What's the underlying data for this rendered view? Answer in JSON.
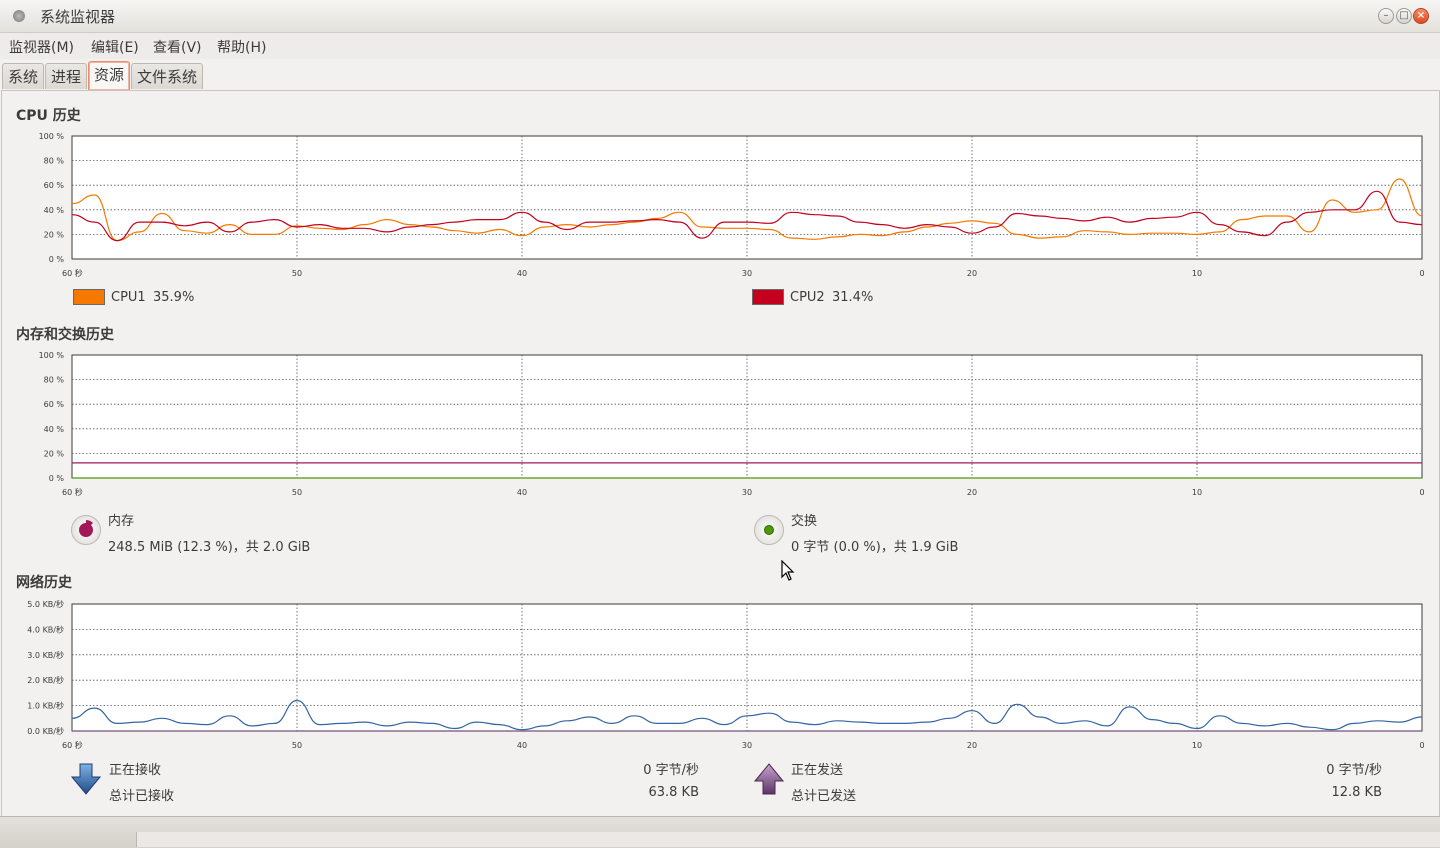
{
  "window": {
    "title": "系统监视器",
    "controls": {
      "minimize": "–",
      "maximize": "□",
      "close": "×"
    }
  },
  "menu": [
    "监视器(M)",
    "编辑(E)",
    "查看(V)",
    "帮助(H)"
  ],
  "tabs": [
    {
      "label": "系统",
      "active": false
    },
    {
      "label": "进程",
      "active": false
    },
    {
      "label": "资源",
      "active": true
    },
    {
      "label": "文件系统",
      "active": false
    }
  ],
  "cpu": {
    "title": "CPU 历史",
    "y_ticks": [
      "100 %",
      "80 %",
      "60 %",
      "40 %",
      "20 %",
      "0 %"
    ],
    "x_ticks": [
      "60 秒",
      "50",
      "40",
      "30",
      "20",
      "10",
      "0"
    ],
    "legend": [
      {
        "name": "CPU1",
        "value": "35.9%",
        "color": "#f57900"
      },
      {
        "name": "CPU2",
        "value": "31.4%",
        "color": "#c4001f"
      }
    ]
  },
  "memory": {
    "title": "内存和交换历史",
    "y_ticks": [
      "100 %",
      "80 %",
      "60 %",
      "40 %",
      "20 %",
      "0 %"
    ],
    "x_ticks": [
      "60 秒",
      "50",
      "40",
      "30",
      "20",
      "10",
      "0"
    ],
    "mem_label": "内存",
    "mem_value": "248.5 MiB (12.3 %)，共 2.0 GiB",
    "mem_color": "#a0185a",
    "swap_label": "交换",
    "swap_value": "0 字节 (0.0 %)，共 1.9 GiB",
    "swap_color": "#4e9a06"
  },
  "network": {
    "title": "网络历史",
    "y_ticks": [
      "5.0 KB/秒",
      "4.0 KB/秒",
      "3.0 KB/秒",
      "2.0 KB/秒",
      "1.0 KB/秒",
      "0.0 KB/秒"
    ],
    "x_ticks": [
      "60 秒",
      "50",
      "40",
      "30",
      "20",
      "10",
      "0"
    ],
    "recv_label": "正在接收",
    "recv_rate": "0 字节/秒",
    "recv_total_label": "总计已接收",
    "recv_total": "63.8 KB",
    "recv_color": "#3465a4",
    "send_label": "正在发送",
    "send_rate": "0 字节/秒",
    "send_total_label": "总计已发送",
    "send_total": "12.8 KB",
    "send_color": "#75507b"
  },
  "chart_data": [
    {
      "type": "line",
      "title": "CPU 历史",
      "ylim": [
        0,
        100
      ],
      "xlim": [
        60,
        0
      ],
      "x": [
        60,
        59,
        58,
        57,
        56,
        55,
        54,
        53,
        52,
        51,
        50,
        49,
        48,
        47,
        46,
        45,
        44,
        43,
        42,
        41,
        40,
        39,
        38,
        37,
        36,
        35,
        34,
        33,
        32,
        31,
        30,
        29,
        28,
        27,
        26,
        25,
        24,
        23,
        22,
        21,
        20,
        19,
        18,
        17,
        16,
        15,
        14,
        13,
        12,
        11,
        10,
        9,
        8,
        7,
        6,
        5,
        4,
        3,
        2,
        1,
        0
      ],
      "series": [
        {
          "name": "CPU1",
          "color": "#f57900",
          "values": [
            45,
            52,
            15,
            22,
            37,
            23,
            21,
            28,
            20,
            20,
            27,
            25,
            24,
            28,
            32,
            28,
            26,
            23,
            21,
            24,
            19,
            26,
            28,
            26,
            28,
            30,
            33,
            38,
            26,
            25,
            25,
            24,
            17,
            16,
            18,
            20,
            19,
            22,
            26,
            29,
            31,
            29,
            20,
            17,
            18,
            23,
            22,
            20,
            21,
            21,
            20,
            22,
            32,
            35,
            35,
            22,
            48,
            38,
            40,
            65,
            35
          ]
        },
        {
          "name": "CPU2",
          "color": "#c4001f",
          "values": [
            36,
            30,
            15,
            30,
            30,
            27,
            30,
            22,
            30,
            32,
            26,
            28,
            25,
            25,
            22,
            26,
            28,
            30,
            32,
            32,
            38,
            30,
            24,
            30,
            30,
            31,
            32,
            30,
            17,
            30,
            30,
            29,
            38,
            36,
            35,
            30,
            28,
            25,
            28,
            26,
            21,
            26,
            37,
            35,
            33,
            31,
            34,
            30,
            33,
            34,
            38,
            28,
            22,
            19,
            30,
            38,
            40,
            40,
            55,
            30,
            28
          ]
        }
      ]
    },
    {
      "type": "line",
      "title": "内存和交换历史",
      "ylim": [
        0,
        100
      ],
      "xlim": [
        60,
        0
      ],
      "x": [
        60,
        0
      ],
      "series": [
        {
          "name": "内存",
          "color": "#a0185a",
          "values": [
            12.3,
            12.3
          ]
        },
        {
          "name": "交换",
          "color": "#4e9a06",
          "values": [
            0,
            0
          ]
        }
      ]
    },
    {
      "type": "line",
      "title": "网络历史",
      "ylim": [
        0,
        5
      ],
      "xlim": [
        60,
        0
      ],
      "x": [
        60,
        59,
        58,
        57,
        56,
        55,
        54,
        53,
        52,
        51,
        50,
        49,
        48,
        47,
        46,
        45,
        44,
        43,
        42,
        41,
        40,
        39,
        38,
        37,
        36,
        35,
        34,
        33,
        32,
        31,
        30,
        29,
        28,
        27,
        26,
        25,
        24,
        23,
        22,
        21,
        20,
        19,
        18,
        17,
        16,
        15,
        14,
        13,
        12,
        11,
        10,
        9,
        8,
        7,
        6,
        5,
        4,
        3,
        2,
        1,
        0
      ],
      "series": [
        {
          "name": "正在接收",
          "color": "#3465a4",
          "values": [
            0.5,
            0.9,
            0.3,
            0.35,
            0.5,
            0.3,
            0.25,
            0.6,
            0.2,
            0.3,
            1.2,
            0.25,
            0.3,
            0.35,
            0.2,
            0.35,
            0.3,
            0.1,
            0.35,
            0.25,
            0.05,
            0.2,
            0.4,
            0.55,
            0.3,
            0.6,
            0.3,
            0.3,
            0.5,
            0.25,
            0.6,
            0.7,
            0.35,
            0.25,
            0.4,
            0.35,
            0.3,
            0.3,
            0.35,
            0.5,
            0.8,
            0.3,
            1.05,
            0.55,
            0.3,
            0.4,
            0.2,
            0.95,
            0.45,
            0.3,
            0.1,
            0.6,
            0.3,
            0.2,
            0.3,
            0.15,
            0.05,
            0.3,
            0.4,
            0.35,
            0.55
          ]
        },
        {
          "name": "正在发送",
          "color": "#75507b",
          "values": [
            0,
            0,
            0,
            0,
            0,
            0,
            0,
            0,
            0,
            0,
            0,
            0,
            0,
            0,
            0,
            0,
            0,
            0,
            0,
            0,
            0,
            0,
            0,
            0,
            0,
            0,
            0,
            0,
            0,
            0,
            0,
            0,
            0,
            0,
            0,
            0,
            0,
            0,
            0,
            0,
            0,
            0,
            0,
            0,
            0,
            0,
            0,
            0,
            0,
            0,
            0,
            0,
            0,
            0,
            0,
            0,
            0,
            0,
            0,
            0,
            0
          ]
        }
      ]
    }
  ]
}
